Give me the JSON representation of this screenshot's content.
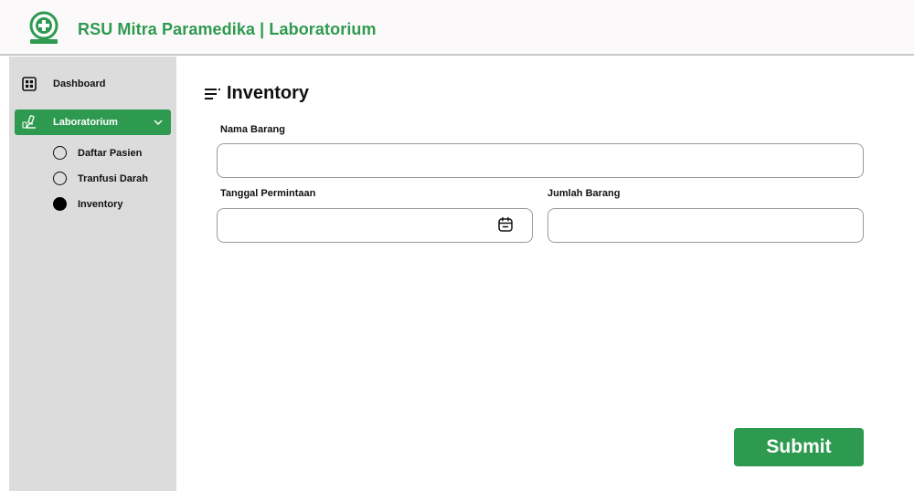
{
  "header": {
    "brand": "RSU Mitra Paramedika | Laboratorium",
    "logo_icon": "hospital-logo-icon"
  },
  "sidebar": {
    "items": [
      {
        "label": "Dashboard",
        "icon": "grid-icon",
        "active": false
      },
      {
        "label": "Laboratorium",
        "icon": "microscope-icon",
        "active": true,
        "expanded": true
      }
    ],
    "subitems": [
      {
        "label": "Daftar Pasien",
        "selected": false
      },
      {
        "label": "Tranfusi Darah",
        "selected": false
      },
      {
        "label": "Inventory",
        "selected": true
      }
    ]
  },
  "main": {
    "title": "Inventory",
    "title_icon": "menu-lines-icon",
    "fields": {
      "nama_barang": {
        "label": "Nama Barang",
        "value": ""
      },
      "tanggal_permintaan": {
        "label": "Tanggal Permintaan",
        "value": "",
        "icon": "calendar-icon"
      },
      "jumlah_barang": {
        "label": "Jumlah Barang",
        "value": ""
      }
    },
    "submit_label": "Submit"
  },
  "colors": {
    "accent": "#2e9a4f",
    "sidebar_bg": "#dcdcdc",
    "header_bg": "#fbf9fa"
  }
}
